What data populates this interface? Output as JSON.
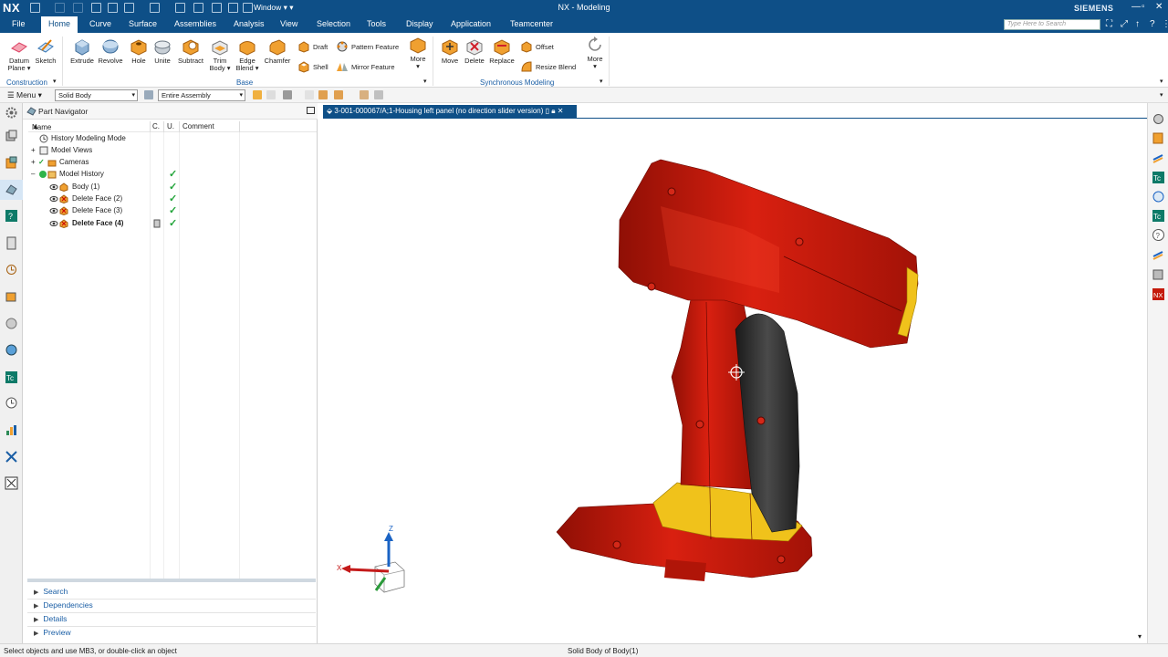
{
  "titlebar": {
    "logo": "NX",
    "window_menu": "Window",
    "app_title": "NX - Modeling",
    "brand": "SIEMENS",
    "window_controls": [
      "—",
      "▫",
      "✕"
    ]
  },
  "menu": {
    "tabs": [
      "File",
      "Home",
      "Curve",
      "Surface",
      "Assemblies",
      "Analysis",
      "View",
      "Selection",
      "Tools",
      "Display",
      "Application",
      "Teamcenter"
    ],
    "active_tab": "Home",
    "search_placeholder": "Type Here to Search"
  },
  "ribbon": {
    "construction": {
      "label": "Construction",
      "buttons": [
        "Datum Plane",
        "Sketch"
      ]
    },
    "base": {
      "label": "Base",
      "buttons": [
        "Extrude",
        "Revolve",
        "Hole",
        "Unite",
        "Subtract",
        "Trim Body",
        "Edge Blend",
        "Chamfer"
      ],
      "small": [
        "Draft",
        "Shell",
        "Pattern Feature",
        "Mirror Feature"
      ],
      "more": "More"
    },
    "synchronous": {
      "label": "Synchronous Modeling",
      "buttons": [
        "Move",
        "Delete",
        "Replace"
      ],
      "small": [
        "Offset",
        "Resize Blend"
      ],
      "more": "More"
    }
  },
  "selbar": {
    "menu": "Menu",
    "filter": "Solid Body",
    "scope": "Entire Assembly"
  },
  "navigator": {
    "title": "Part Navigator",
    "columns": {
      "name": "Name",
      "c": "C.",
      "u": "U.",
      "comment": "Comment"
    },
    "rows": [
      {
        "label": "History Modeling Mode"
      },
      {
        "label": "Model Views"
      },
      {
        "label": "Cameras"
      },
      {
        "label": "Model History"
      },
      {
        "label": "Body (1)"
      },
      {
        "label": "Delete Face (2)"
      },
      {
        "label": "Delete Face (3)"
      },
      {
        "label": "Delete Face (4)"
      }
    ],
    "panels": [
      "Search",
      "Dependencies",
      "Details",
      "Preview"
    ]
  },
  "graphics": {
    "tab_title": "3-001-000067/A;1-Housing left panel (no direction slider version)",
    "axis_x": "X",
    "axis_z": "Z"
  },
  "colors": {
    "title_bg": "#0e4f87",
    "part_red": "#c41a0a",
    "part_yellow": "#f0c21b",
    "grip_black": "#262626",
    "check_green": "#22a43a"
  },
  "status": {
    "prompt": "Select objects and use MB3, or double-click an object",
    "selection": "Solid Body of Body(1)"
  }
}
